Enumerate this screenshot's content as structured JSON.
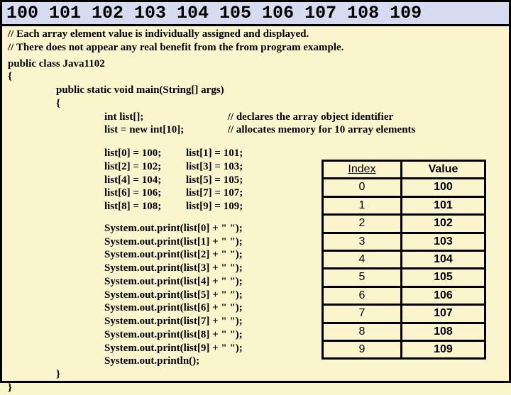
{
  "output_line": "100 101 102 103 104 105 106 107 108 109",
  "comments": {
    "c1": "// Each array element value is individually assigned and displayed.",
    "c2": "// There does not appear any real benefit from the from program example."
  },
  "class_decl": "public class Java1102",
  "brace_open": "{",
  "main_sig": "public static void main(String[] args)",
  "brace_open2": "{",
  "decl_line": "int list[];",
  "decl_comment": "// declares the array object identifier",
  "alloc_line": "list = new int[10];",
  "alloc_comment": "// allocates memory for 10 array elements",
  "assigns": [
    {
      "a": "list[0] = 100;",
      "b": "list[1] = 101;"
    },
    {
      "a": "list[2] = 102;",
      "b": "list[3] = 103;"
    },
    {
      "a": "list[4] = 104;",
      "b": "list[5] = 105;"
    },
    {
      "a": "list[6] = 106;",
      "b": "list[7] = 107;"
    },
    {
      "a": "list[8] = 108;",
      "b": "list[9] = 109;"
    }
  ],
  "prints": [
    "System.out.print(list[0] + \" \");",
    "System.out.print(list[1] + \" \");",
    "System.out.print(list[2] + \" \");",
    "System.out.print(list[3] + \" \");",
    "System.out.print(list[4] + \" \");",
    "System.out.print(list[5] + \" \");",
    "System.out.print(list[6] + \" \");",
    "System.out.print(list[7] + \" \");",
    "System.out.print(list[8] + \" \");",
    "System.out.print(list[9] + \" \");",
    "System.out.println();"
  ],
  "brace_close2": "}",
  "brace_close": "}",
  "table": {
    "h_index": "Index",
    "h_value": "Value",
    "rows": [
      {
        "i": "0",
        "v": "100"
      },
      {
        "i": "1",
        "v": "101"
      },
      {
        "i": "2",
        "v": "102"
      },
      {
        "i": "3",
        "v": "103"
      },
      {
        "i": "4",
        "v": "104"
      },
      {
        "i": "5",
        "v": "105"
      },
      {
        "i": "6",
        "v": "106"
      },
      {
        "i": "7",
        "v": "107"
      },
      {
        "i": "8",
        "v": "108"
      },
      {
        "i": "9",
        "v": "109"
      }
    ]
  },
  "chart_data": {
    "type": "table",
    "title": "Array index/value table",
    "columns": [
      "Index",
      "Value"
    ],
    "rows": [
      [
        0,
        100
      ],
      [
        1,
        101
      ],
      [
        2,
        102
      ],
      [
        3,
        103
      ],
      [
        4,
        104
      ],
      [
        5,
        105
      ],
      [
        6,
        106
      ],
      [
        7,
        107
      ],
      [
        8,
        108
      ],
      [
        9,
        109
      ]
    ]
  }
}
